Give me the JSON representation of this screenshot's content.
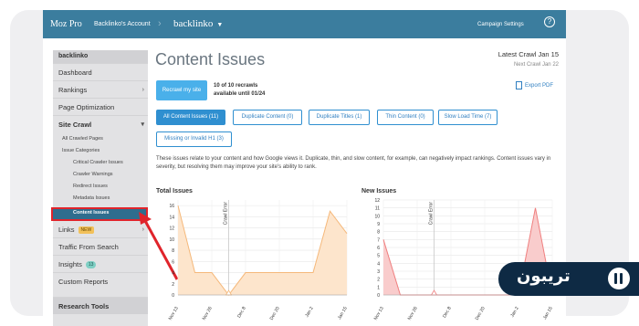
{
  "topbar": {
    "brand": "Moz Pro",
    "account": "Backlinko's Account",
    "project": "backlinko",
    "campaign_settings": "Campaign Settings",
    "help": "?"
  },
  "sidebar": {
    "header": "backlinko",
    "items": [
      {
        "label": "Dashboard"
      },
      {
        "label": "Rankings"
      },
      {
        "label": "Page Optimization"
      },
      {
        "label": "Site Crawl"
      },
      {
        "label": "All Crawled Pages"
      },
      {
        "label": "Issue Categories"
      },
      {
        "label": "Critical Crawler Issues"
      },
      {
        "label": "Crawler Warnings"
      },
      {
        "label": "Redirect Issues"
      },
      {
        "label": "Metadata Issues"
      },
      {
        "label": "Content Issues"
      },
      {
        "label": "Links"
      },
      {
        "label": "Traffic From Search"
      },
      {
        "label": "Insights"
      },
      {
        "label": "Custom Reports"
      },
      {
        "label": "Research Tools"
      }
    ],
    "links_badge": "NEW",
    "insights_badge": "13"
  },
  "page": {
    "title": "Content Issues",
    "latest_crawl": "Latest Crawl Jan 15",
    "next_crawl": "Next Crawl Jan 22",
    "recrawl_button": "Recrawl my site",
    "recrawl_info_line1": "10 of 10 recrawls",
    "recrawl_info_line2": "available until 01/24",
    "export_pdf": "Export PDF",
    "description": "These issues relate to your content and how Google views it. Duplicate, thin, and slow content, for example, can negatively impact rankings. Content issues vary in severity, but resolving them may improve your site's ability to rank."
  },
  "tabs": [
    {
      "label": "All Content Issues (11)"
    },
    {
      "label": "Duplicate Content (0)"
    },
    {
      "label": "Duplicate Titles (1)"
    },
    {
      "label": "Thin Content (0)"
    },
    {
      "label": "Slow Load Time (7)"
    },
    {
      "label": "Missing or Invalid H1 (3)"
    }
  ],
  "overlay_logo": {
    "text": "تریبون"
  },
  "chart_data": [
    {
      "type": "area",
      "title": "Total Issues",
      "x_ticks": [
        "Nov 13",
        "Nov 26",
        "Dec 8",
        "Dec 20",
        "Jan 2",
        "Jan 15"
      ],
      "y_ticks": [
        0,
        2,
        4,
        6,
        8,
        10,
        12,
        14,
        16
      ],
      "ylim": [
        0,
        17
      ],
      "annotation": "Crawl Error",
      "color": "#f5b87a",
      "fill": "#fde5cc",
      "x": [
        "Nov 13",
        "Nov 19",
        "Nov 26",
        "Dec 2",
        "Dec 8",
        "Dec 14",
        "Dec 20",
        "Dec 26",
        "Jan 2",
        "Jan 8",
        "Jan 15"
      ],
      "y": [
        16,
        4,
        4,
        0,
        4,
        4,
        4,
        4,
        4,
        15,
        11
      ]
    },
    {
      "type": "area",
      "title": "New Issues",
      "x_ticks": [
        "Nov 13",
        "Nov 26",
        "Dec 8",
        "Dec 20",
        "Jan 2",
        "Jan 15"
      ],
      "y_ticks": [
        0,
        1,
        2,
        3,
        4,
        5,
        6,
        7,
        8,
        9,
        10,
        11,
        12
      ],
      "ylim": [
        0,
        12
      ],
      "annotation": "Crawl Error",
      "color": "#ef7f7f",
      "fill": "#f9cccc",
      "x": [
        "Nov 13",
        "Nov 19",
        "Nov 26",
        "Dec 2",
        "Dec 8",
        "Dec 14",
        "Dec 20",
        "Dec 26",
        "Jan 2",
        "Jan 8",
        "Jan 15"
      ],
      "y": [
        7,
        0,
        0,
        0,
        0,
        0,
        0,
        0,
        0,
        11,
        0
      ]
    }
  ]
}
